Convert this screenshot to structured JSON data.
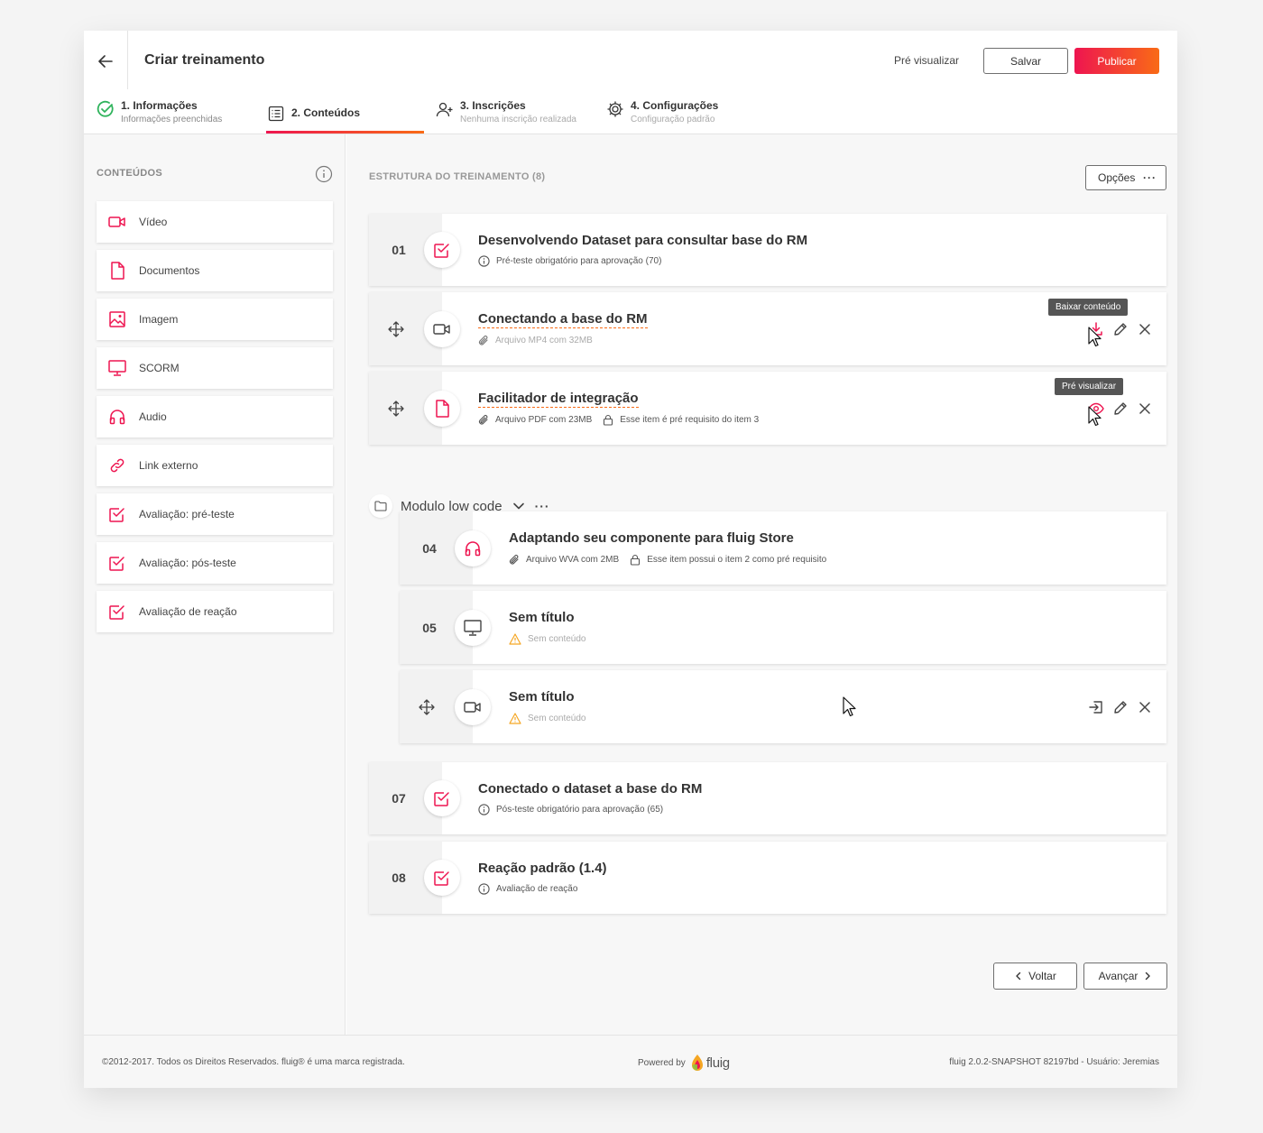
{
  "header": {
    "title": "Criar treinamento",
    "preview_label": "Pré visualizar",
    "save_label": "Salvar",
    "publish_label": "Publicar"
  },
  "steps": [
    {
      "title": "1. Informações",
      "subtitle": "Informações preenchidas"
    },
    {
      "title": "2. Conteúdos"
    },
    {
      "title": "3. Inscrições",
      "subtitle": "Nenhuma inscrição realizada"
    },
    {
      "title": "4. Configurações",
      "subtitle": "Configuração padrão"
    }
  ],
  "sidebar": {
    "heading": "CONTEÚDOS",
    "items": [
      {
        "label": "Vídeo",
        "icon": "video-icon"
      },
      {
        "label": "Documentos",
        "icon": "document-icon"
      },
      {
        "label": "Imagem",
        "icon": "image-icon"
      },
      {
        "label": "SCORM",
        "icon": "monitor-icon"
      },
      {
        "label": "Audio",
        "icon": "headphones-icon"
      },
      {
        "label": "Link externo",
        "icon": "link-icon"
      },
      {
        "label": "Avaliação: pré-teste",
        "icon": "checkbox-icon"
      },
      {
        "label": "Avaliação: pós-teste",
        "icon": "checkbox-icon"
      },
      {
        "label": "Avaliação de reação",
        "icon": "checkbox-icon"
      }
    ]
  },
  "main": {
    "heading": "ESTRUTURA DO TREINAMENTO (8)",
    "options_label": "Opções",
    "options_dots": "···",
    "module": {
      "name": "Modulo low code",
      "dots": "···"
    },
    "items": [
      {
        "number": "01",
        "title": "Desenvolvendo Dataset para consultar base do RM",
        "meta": [
          "Pré-teste obrigatório para aprovação (70)"
        ]
      },
      {
        "title": "Conectando a base do RM",
        "meta": [
          "Arquivo MP4 com 32MB"
        ],
        "tooltip": "Baixar conteúdo"
      },
      {
        "title": "Facilitador de integração",
        "meta": [
          "Arquivo PDF com 23MB",
          "Esse item é pré requisito do item 3"
        ],
        "tooltip": "Pré visualizar"
      },
      {
        "number": "04",
        "title": "Adaptando seu componente para fluig Store",
        "meta": [
          "Arquivo WVA com 2MB",
          "Esse item possui o item 2 como pré requisito"
        ]
      },
      {
        "number": "05",
        "title": "Sem título",
        "meta": [
          "Sem conteúdo"
        ]
      },
      {
        "title": "Sem título",
        "meta": [
          "Sem conteúdo"
        ]
      },
      {
        "number": "07",
        "title": "Conectado o dataset a base do RM",
        "meta": [
          "Pós-teste obrigatório para aprovação (65)"
        ]
      },
      {
        "number": "08",
        "title": "Reação padrão (1.4)",
        "meta": [
          "Avaliação de reação"
        ]
      }
    ],
    "back_label": "Voltar",
    "next_label": "Avançar"
  },
  "footer": {
    "copyright": "©2012-2017. Todos os Direitos Reservados. fluig® é uma marca registrada.",
    "powered_by": "Powered by",
    "brand": "fluig",
    "version": "fluig 2.0.2-SNAPSHOT 82197bd - Usuário: Jeremias"
  },
  "colors": {
    "accent": "#ee1550",
    "accent_end": "#f96b16",
    "success": "#2fb35c",
    "warning": "#f5a623"
  }
}
